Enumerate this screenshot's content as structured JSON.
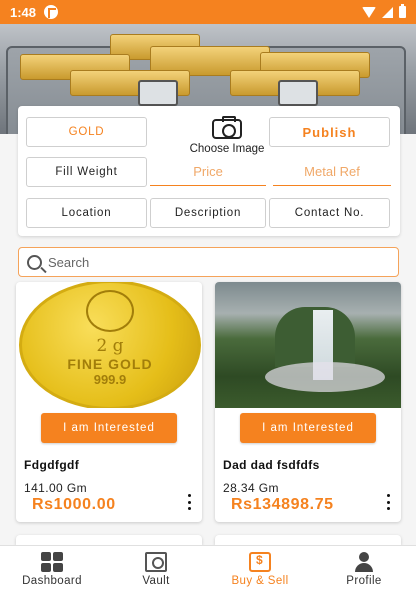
{
  "status_bar": {
    "time": "1:48"
  },
  "form": {
    "gold_label": "GOLD",
    "choose_image_label": "Choose Image",
    "publish_label": "Publish",
    "fill_weight_label": "Fill Weight",
    "price_placeholder": "Price",
    "metal_ref_placeholder": "Metal Ref",
    "location_label": "Location",
    "description_label": "Description",
    "contact_label": "Contact No."
  },
  "search": {
    "placeholder": "Search"
  },
  "products": [
    {
      "image": "gold-coin",
      "coin_text": [
        "2 g",
        "FINE GOLD",
        "999.9"
      ],
      "interested_label": "I am Interested",
      "name": "Fdgdfgdf",
      "weight": "141.00 Gm",
      "price": "Rs1000.00"
    },
    {
      "image": "waterfall",
      "interested_label": "I am Interested",
      "name": "Dad dad fsdfdfs",
      "weight": "28.34 Gm",
      "price": "Rs134898.75"
    }
  ],
  "bottom_nav": [
    {
      "label": "Dashboard",
      "icon": "dashboard-icon"
    },
    {
      "label": "Vault",
      "icon": "vault-icon"
    },
    {
      "label": "Buy & Sell",
      "icon": "buy-sell-icon",
      "active": true
    },
    {
      "label": "Profile",
      "icon": "profile-icon"
    }
  ],
  "colors": {
    "accent": "#f5821f"
  }
}
